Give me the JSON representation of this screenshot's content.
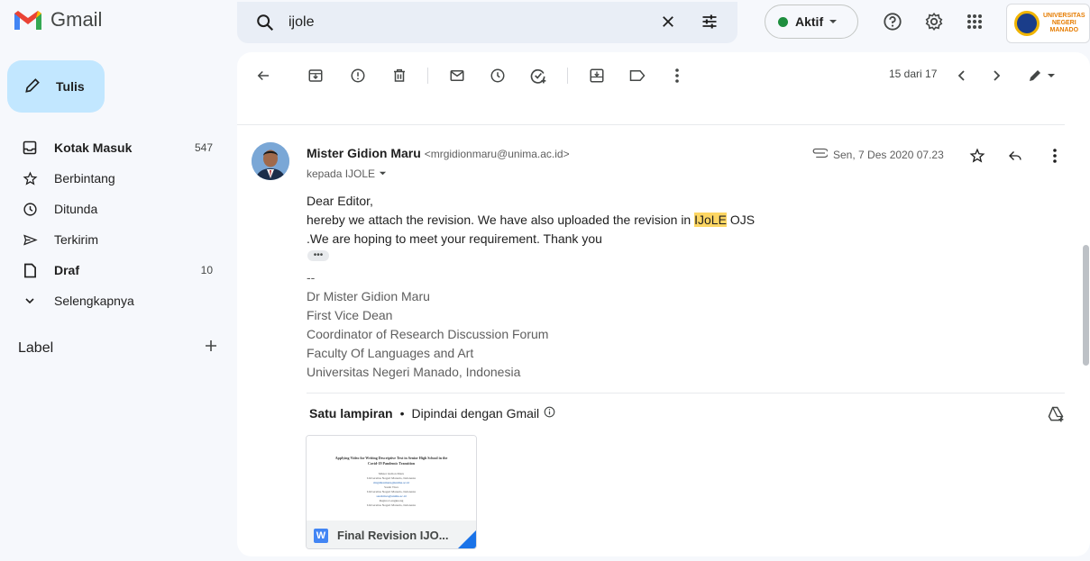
{
  "app": {
    "name": "Gmail"
  },
  "search": {
    "query": "ijole"
  },
  "status": {
    "label": "Aktif",
    "color": "#1e8e3e"
  },
  "account": {
    "line1": "UNIVERSITAS",
    "line2": "NEGERI",
    "line3": "MANADO"
  },
  "compose": {
    "label": "Tulis"
  },
  "sidebar": {
    "items": [
      {
        "label": "Kotak Masuk",
        "count": "547",
        "icon": "inbox-icon",
        "bold": true
      },
      {
        "label": "Berbintang",
        "count": "",
        "icon": "star-icon",
        "bold": false
      },
      {
        "label": "Ditunda",
        "count": "",
        "icon": "clock-icon",
        "bold": false
      },
      {
        "label": "Terkirim",
        "count": "",
        "icon": "send-icon",
        "bold": false
      },
      {
        "label": "Draf",
        "count": "10",
        "icon": "draft-icon",
        "bold": true
      },
      {
        "label": "Selengkapnya",
        "count": "",
        "icon": "chevron-down-icon",
        "bold": false
      }
    ],
    "labels_heading": "Label"
  },
  "toolbar": {
    "pager": "15 dari 17"
  },
  "message": {
    "sender_name": "Mister Gidion Maru",
    "sender_email": "<mrgidionmaru@unima.ac.id>",
    "recipient": "kepada IJOLE",
    "date": "Sen, 7 Des 2020 07.23",
    "greeting": "Dear Editor,",
    "line2_before": "hereby we attach the revision. We have also uploaded the revision  in ",
    "line2_highlight": "IJoLE",
    "line2_after": " OJS",
    "line3": ".We are hoping to meet your requirement. Thank you",
    "sig_dash": "--",
    "signature": [
      "Dr Mister Gidion Maru",
      "First Vice Dean",
      "Coordinator of Research Discussion Forum",
      "Faculty Of Languages and Art",
      "Universitas Negeri Manado, Indonesia"
    ]
  },
  "attachments": {
    "title": "Satu lampiran",
    "bullet": "•",
    "scan_note": "Dipindai dengan Gmail",
    "file": {
      "name": "Final Revision IJO...",
      "type_letter": "W",
      "preview_title": "Applying Video for Writing Descriptive Text in Senior High School in the Covid-19 Pandemic Transition"
    }
  }
}
